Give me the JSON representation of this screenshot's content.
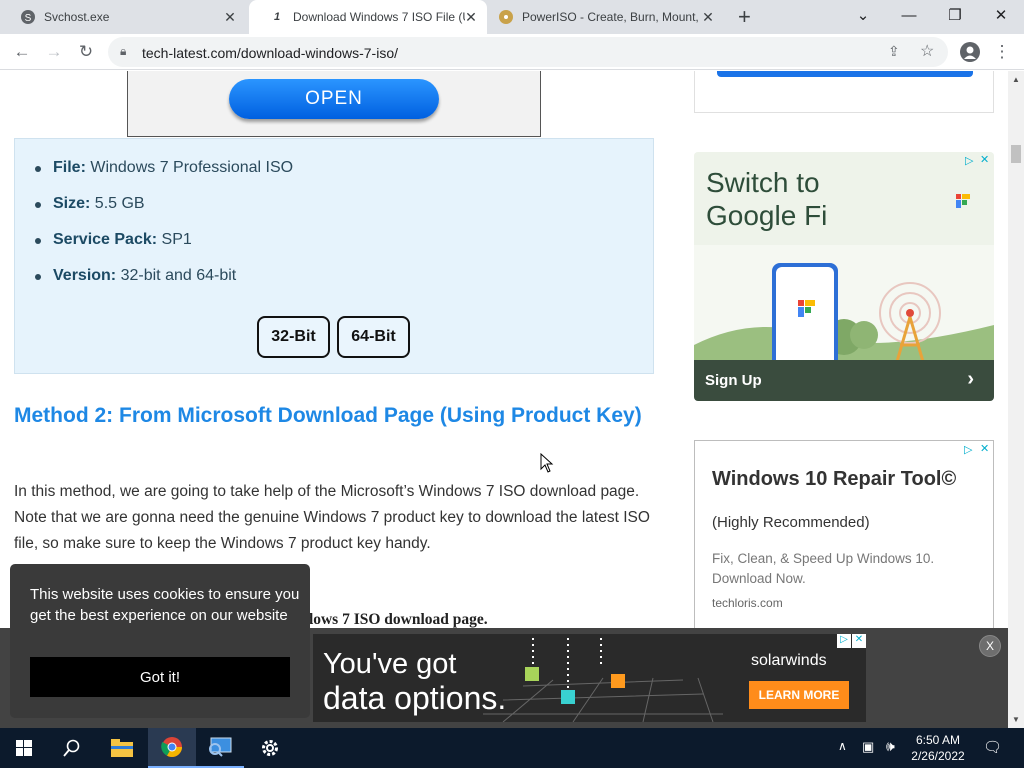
{
  "tabs": [
    {
      "title": "Svchost.exe",
      "favicon": "S"
    },
    {
      "title": "Download Windows 7 ISO File (U",
      "favicon": "1"
    },
    {
      "title": "PowerISO - Create, Burn, Mount,",
      "favicon": "●"
    }
  ],
  "window": {
    "minimize": "—",
    "maximize": "❐",
    "close": "✕",
    "tabsearch": "⌄",
    "newtab": "+"
  },
  "address": {
    "url": "tech-latest.com/download-windows-7-iso/"
  },
  "open_button": "OPEN",
  "file_info": [
    {
      "label": "File:",
      "value": "Windows 7 Professional ISO"
    },
    {
      "label": "Size:",
      "value": "5.5 GB"
    },
    {
      "label": "Service Pack:",
      "value": "SP1"
    },
    {
      "label": "Version:",
      "value": "32-bit and 64-bit"
    }
  ],
  "buttons": {
    "bit32": "32-Bit",
    "bit64": "64-Bit"
  },
  "method_title": "Method 2: From Microsoft Download Page (Using Product Key)",
  "paragraph": "In this method, we are going to take help of the Microsoft’s Windows 7 ISO download page. Note that we are gonna need the genuine Windows 7 product key to download the latest ISO file, so make sure to keep the Windows 7 product key handy.",
  "paragraph2_fragment": "ndows 7 ISO download page.",
  "ad_googlefi": {
    "title": "Switch to Google Fi",
    "cta": "Sign Up"
  },
  "ad_repair": {
    "title": "Windows 10 Repair Tool©",
    "subtitle": "(Highly Recommended)",
    "desc": "Fix, Clean, & Speed Up Windows 10. Download Now.",
    "domain": "techloris.com"
  },
  "banner": {
    "line1": "You've got",
    "line2": "data options.",
    "brand": "solarwinds",
    "cta": "LEARN MORE",
    "close": "X"
  },
  "cookie": {
    "text": "This website uses cookies to ensure you get the best experience on our website",
    "button": "Got it!"
  },
  "taskbar": {
    "time": "6:50 AM",
    "date": "2/26/2022"
  },
  "colors": {
    "accent": "#1e88e5",
    "taskbar": "#0c1a2c",
    "info_bg": "#e6f3fc"
  }
}
